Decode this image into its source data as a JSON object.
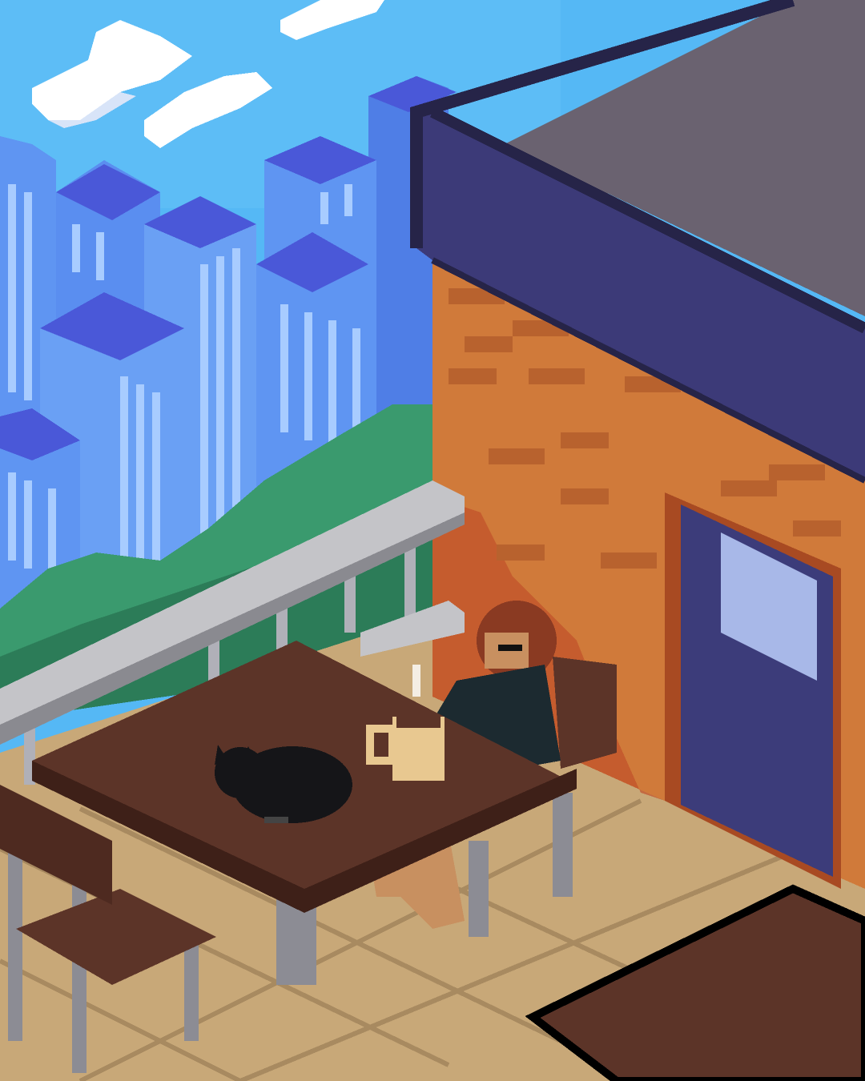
{
  "palette": {
    "sky": "#55b8f5",
    "sky_light": "#7ccaf8",
    "cloud": "#ffffff",
    "cloud_shade": "#d8e4f8",
    "tower_face": "#5f95f2",
    "tower_side": "#4f7ee6",
    "tower_top": "#4a58d8",
    "tower_window": "#a8ccff",
    "foliage": "#3a9a6e",
    "foliage_dark": "#2c7c58",
    "roof_edge": "#262448",
    "roof_fascia": "#3c3a78",
    "roof_top": "#6a6270",
    "wall": "#d07a3a",
    "brick": "#b8622e",
    "wall_shadow": "#c0502a",
    "door": "#3c3c7a",
    "door_window": "#a8b8e8",
    "railing": "#c4c4c8",
    "railing_dark": "#8a8a90",
    "floor": "#c8a878",
    "floor_line": "#a88a60",
    "table": "#5c3428",
    "table_dark": "#3e2018",
    "metal_leg": "#8c8c94",
    "cat": "#151518",
    "mug": "#e8c890",
    "hair": "#8a3a22",
    "skin": "#c89060",
    "clothes": "#1c2a30"
  }
}
